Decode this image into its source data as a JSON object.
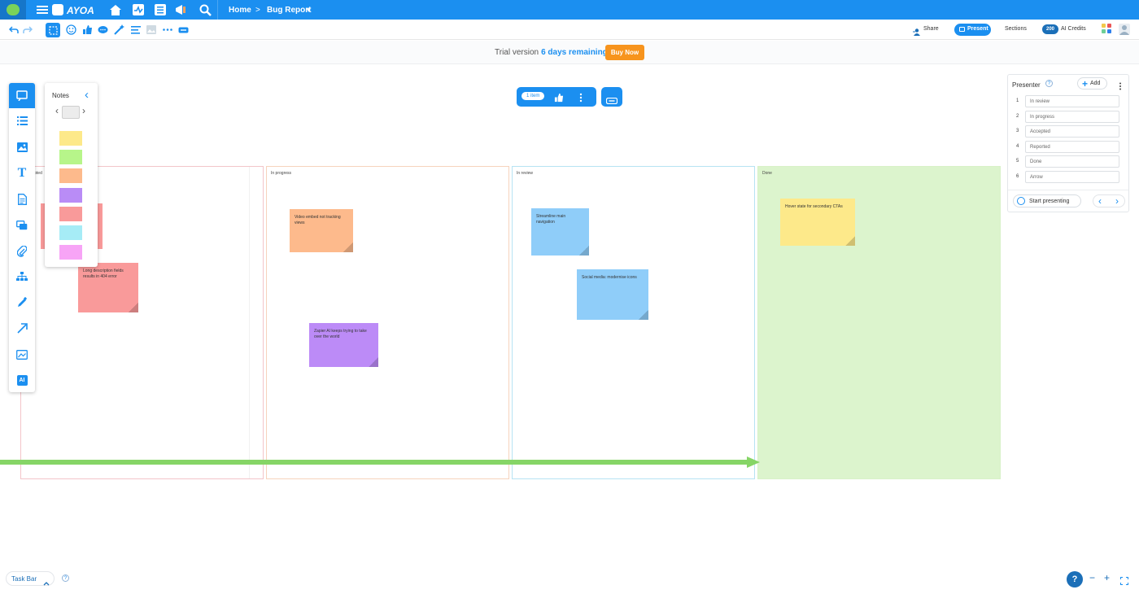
{
  "topbar": {
    "logo_text": "AYOA",
    "breadcrumb_home": "Home",
    "breadcrumb_sep": ">",
    "breadcrumb_current": "Bug Report",
    "dropdown_caret": "▾"
  },
  "toolbar": {
    "share_label": "Share",
    "present_label": "Present",
    "sections_label": "Sections",
    "credits_count": "200",
    "credits_label": "AI Credits"
  },
  "trial": {
    "prefix": "Trial version",
    "remaining": "6 days remaining",
    "buy_label": "Buy Now"
  },
  "floatbar": {
    "item_count": "1 item"
  },
  "notes_panel": {
    "title": "Notes",
    "collapse_glyph": "‹",
    "prev_glyph": "‹",
    "next_glyph": "›",
    "swatches": [
      "#fde98a",
      "#b7f58a",
      "#fdba8c",
      "#b98cf6",
      "#f99a9a",
      "#a6ecf6",
      "#f7a4f6"
    ]
  },
  "rail": {
    "ai_label": "AI"
  },
  "columns": [
    {
      "title": "Accepted",
      "border": "#f3c5c9",
      "bg": "#ffffff"
    },
    {
      "title": "In progress",
      "border": "#f6d3bd",
      "bg": "#ffffff"
    },
    {
      "title": "In review",
      "border": "#b7e3f3",
      "bg": "#ffffff"
    },
    {
      "title": "Done",
      "border": "#d8f1c8",
      "bg": "#dcf4cd"
    }
  ],
  "notes": [
    {
      "text": "",
      "color": "#f99a9a"
    },
    {
      "text": "Long description fields results in 404 error",
      "color": "#f99a9a"
    },
    {
      "text": "Video embed not tracking views",
      "color": "#fdba8c"
    },
    {
      "text": "Zapier AI keeps trying to take over the world",
      "color": "#bc8bf7"
    },
    {
      "text": "Streamline main navigation",
      "color": "#8fcdf9"
    },
    {
      "text": "Social media: modernise icons",
      "color": "#8fcdf9"
    },
    {
      "text": "Hover state for secondary CTAs",
      "color": "#fde98a"
    }
  ],
  "arrow_color": "#86d566",
  "presenter": {
    "title": "Presenter",
    "help": "?",
    "add_label": "Add",
    "rows": [
      {
        "num": "1",
        "label": "In review"
      },
      {
        "num": "2",
        "label": "In progress"
      },
      {
        "num": "3",
        "label": "Accepted"
      },
      {
        "num": "4",
        "label": "Reported"
      },
      {
        "num": "5",
        "label": "Done"
      },
      {
        "num": "6",
        "label": "Arrow"
      }
    ],
    "start_label": "Start presenting"
  },
  "bottom": {
    "taskbar_label": "Task Bar",
    "help_glyph": "?",
    "zoom_out": "−",
    "zoom_in": "+"
  }
}
